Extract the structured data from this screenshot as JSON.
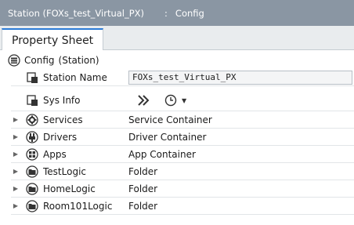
{
  "title_bar": {
    "station": "Station (FOXs_test_Virtual_PX)",
    "separator": ":",
    "location": "Config"
  },
  "tab": {
    "label": "Property Sheet"
  },
  "root": {
    "label": "Config",
    "type": "(Station)"
  },
  "properties": {
    "station_name": {
      "label": "Station Name",
      "value": "FOXs_test_Virtual_PX"
    },
    "sys_info": {
      "label": "Sys Info"
    }
  },
  "children": [
    {
      "name": "Services",
      "value": "Service Container",
      "icon": "services-icon"
    },
    {
      "name": "Drivers",
      "value": "Driver Container",
      "icon": "drivers-icon"
    },
    {
      "name": "Apps",
      "value": "App Container",
      "icon": "apps-icon"
    },
    {
      "name": "TestLogic",
      "value": "Folder",
      "icon": "folder-icon"
    },
    {
      "name": "HomeLogic",
      "value": "Folder",
      "icon": "folder-icon"
    },
    {
      "name": "Room101Logic",
      "value": "Folder",
      "icon": "folder-icon"
    }
  ],
  "colors": {
    "title_bar_bg": "#8a96a3",
    "tab_accent": "#2c7bd6",
    "row_divider": "#e2e5e8"
  }
}
